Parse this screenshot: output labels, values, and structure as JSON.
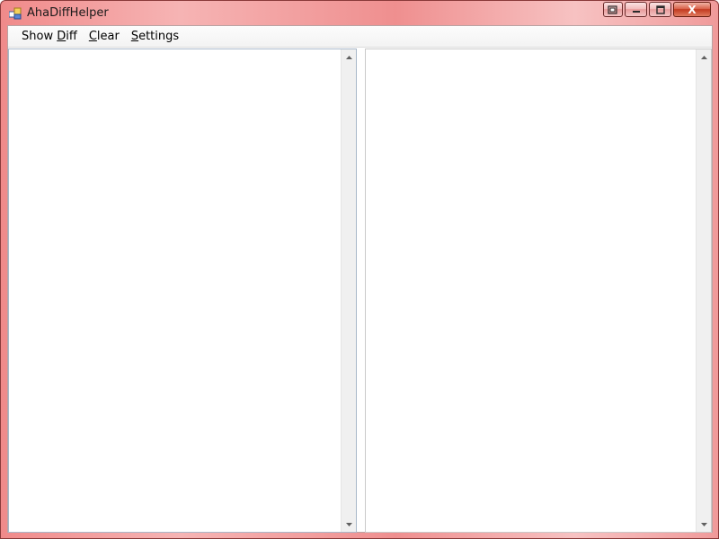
{
  "window": {
    "title": "AhaDiffHelper",
    "icons": {
      "app": "app-window-icon",
      "restore": "restore-window-icon",
      "minimize": "minimize-icon",
      "maximize": "maximize-icon",
      "close": "close-icon"
    },
    "close_glyph": "X"
  },
  "menu": {
    "items": [
      {
        "prefix": "Show ",
        "mnemonic": "D",
        "suffix": "iff"
      },
      {
        "prefix": "",
        "mnemonic": "C",
        "suffix": "lear"
      },
      {
        "prefix": "",
        "mnemonic": "S",
        "suffix": "ettings"
      }
    ]
  },
  "panes": {
    "left": {
      "value": ""
    },
    "right": {
      "value": ""
    }
  },
  "colors": {
    "titlebar_accent": "#f08a8a",
    "close_button": "#c2391f"
  }
}
